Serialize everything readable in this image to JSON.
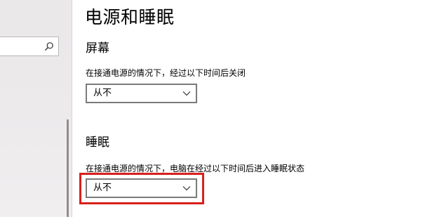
{
  "page": {
    "title": "电源和睡眠"
  },
  "search": {
    "icon": "search-icon",
    "value": ""
  },
  "screen_section": {
    "title": "屏幕",
    "label": "在接通电源的情况下，经过以下时间后关闭",
    "dropdown_value": "从不",
    "dropdown_icon": "chevron-down-icon"
  },
  "sleep_section": {
    "title": "睡眠",
    "label": "在接通电源的情况下，电脑在经过以下时间后进入睡眠状态",
    "dropdown_value": "从不",
    "dropdown_icon": "chevron-down-icon"
  },
  "colors": {
    "highlight": "#d8201c",
    "dropdown_border": "#7c7a7b",
    "nav_background": "#eae8e9"
  }
}
